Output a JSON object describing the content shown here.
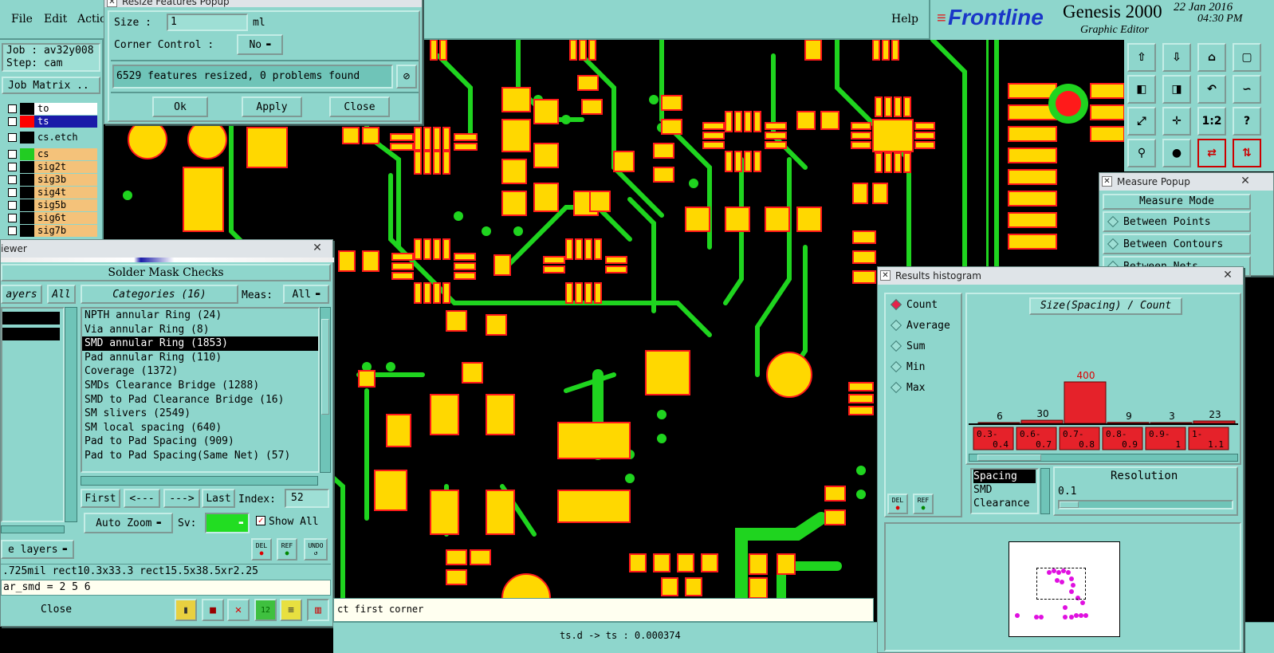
{
  "menu": {
    "file": "File",
    "edit": "Edit",
    "actions": "Actio",
    "help": "Help"
  },
  "brand": {
    "logo": "Frontline",
    "product": "Genesis 2000",
    "subtitle": "Graphic Editor",
    "date": "22 Jan 2016",
    "time": "04:30 PM"
  },
  "job": {
    "job_line": "Job : av32y008",
    "step_line": "Step: cam",
    "matrix_button": "Job Matrix .."
  },
  "layers": [
    {
      "name": "to",
      "swatch": "#000000",
      "bg": "#ffffff"
    },
    {
      "name": "ts",
      "swatch": "#ff0000",
      "bg": "#1a1aa8"
    },
    {
      "name": "cs.etch",
      "swatch": "#000000",
      "bg": "#8ed6cc"
    },
    {
      "name": "cs",
      "swatch": "#22cc22",
      "bg": "#f4c27a"
    },
    {
      "name": "sig2t",
      "swatch": "#000000",
      "bg": "#f4c27a"
    },
    {
      "name": "sig3b",
      "swatch": "#000000",
      "bg": "#f4c27a"
    },
    {
      "name": "sig4t",
      "swatch": "#000000",
      "bg": "#f4c27a"
    },
    {
      "name": "sig5b",
      "swatch": "#000000",
      "bg": "#f4c27a"
    },
    {
      "name": "sig6t",
      "swatch": "#000000",
      "bg": "#f4c27a"
    },
    {
      "name": "sig7b",
      "swatch": "#000000",
      "bg": "#f4c27a"
    }
  ],
  "resize_popup": {
    "title": "Resize Features Popup",
    "size_label": "Size :",
    "size_value": "1",
    "size_unit": "ml",
    "corner_label": "Corner Control :",
    "corner_value": "No",
    "status": "6529 features resized, 0 problems found",
    "ok": "Ok",
    "apply": "Apply",
    "close": "Close"
  },
  "viewer": {
    "title": "iewer",
    "close": "✕",
    "panel_title": "Solder Mask Checks",
    "layers_tab": "ayers",
    "all_btn": "All",
    "categories_tab": "Categories (16)",
    "meas_label": "Meas:",
    "meas_value": "All",
    "categories": [
      "NPTH annular Ring (24)",
      "Via annular Ring (8)",
      "SMD annular Ring (1853)",
      "Pad annular Ring (110)",
      "Coverage (1372)",
      "SMDs Clearance Bridge (1288)",
      "SMD to Pad Clearance Bridge (16)",
      "SM slivers (2549)",
      "SM local spacing (640)",
      "Pad to Pad Spacing (909)",
      "Pad to Pad Spacing(Same Net) (57)"
    ],
    "selected_index": 2,
    "first": "First",
    "prev": "<---",
    "next": "--->",
    "last": "Last",
    "index_label": "Index:",
    "index_value": "52",
    "auto_zoom": "Auto Zoom",
    "sv_label": "Sv:",
    "show_all": "Show All",
    "layers_dd": "e layers",
    "del": "DEL",
    "ref": "REF",
    "undo": "UNDO",
    "info_line": ".725mil  rect10.3x33.3  rect15.5x38.5xr2.25",
    "info_line2": "ar_smd = 2 5 6",
    "close_btn": "Close"
  },
  "status": {
    "prompt": "ct first corner",
    "coords": "ts.d -> ts : 0.000374"
  },
  "measure": {
    "title": "Measure Popup",
    "mode_label": "Measure Mode",
    "options": [
      "Between Points",
      "Between Contours",
      "Between Nets"
    ]
  },
  "histogram": {
    "title": "Results histogram",
    "modes": [
      "Count",
      "Average",
      "Sum",
      "Min",
      "Max"
    ],
    "selected_mode": 0,
    "chart_title": "Size(Spacing) / Count",
    "bins": [
      {
        "label": "0.3-0.4",
        "count": 6
      },
      {
        "label": "0.6-0.7",
        "count": 30
      },
      {
        "label": "0.7-0.8",
        "count": 400
      },
      {
        "label": "0.8-0.9",
        "count": 9
      },
      {
        "label": "0.9-1",
        "count": 3
      },
      {
        "label": "1-1.1",
        "count": 23
      }
    ],
    "types": [
      "Spacing",
      "SMD",
      "Clearance"
    ],
    "resolution_label": "Resolution",
    "resolution_value": "0.1",
    "del": "DEL",
    "ref": "REF"
  },
  "chart_data": {
    "type": "bar",
    "title": "Size(Spacing) / Count",
    "categories": [
      "0.3-0.4",
      "0.6-0.7",
      "0.7-0.8",
      "0.8-0.9",
      "0.9-1",
      "1-1.1"
    ],
    "values": [
      6,
      30,
      400,
      9,
      3,
      23
    ]
  },
  "toolbar_icons": [
    "home-up-icon",
    "home-down-icon",
    "home-icon",
    "window-icon",
    "pan-left-icon",
    "pan-right-icon",
    "undo-view-icon",
    "redraw-icon",
    "zoom-fit-icon",
    "zoom-center-icon",
    "zoom-1-2-icon",
    "help-icon",
    "tool-icon",
    "probe-icon",
    "route-red-icon",
    "route-blue-icon"
  ],
  "colors": {
    "panel": "#8ed6cc",
    "pad": "#ffd800",
    "trace": "#1fd41f",
    "outline": "#ff1a1a",
    "background": "#000000"
  }
}
